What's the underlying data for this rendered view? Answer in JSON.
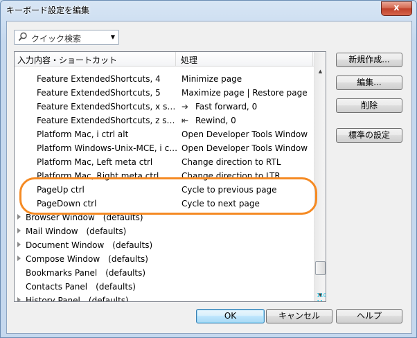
{
  "window": {
    "title": "キーボード設定を編集",
    "close_label": "x"
  },
  "search": {
    "placeholder": "クイック検索"
  },
  "list": {
    "col_shortcut": "入力内容・ショートカット",
    "col_action": "処理",
    "rows": [
      {
        "key": "Feature ExtendedShortcuts, 4",
        "action": "Minimize page"
      },
      {
        "key": "Feature ExtendedShortcuts, 5",
        "action": "Maximize page | Restore page"
      },
      {
        "key": "Feature ExtendedShortcuts, x shift",
        "icon": "fast-forward-icon",
        "action": "Fast forward, 0"
      },
      {
        "key": "Feature ExtendedShortcuts, z shift",
        "icon": "rewind-icon",
        "action": "Rewind, 0"
      },
      {
        "key": "Platform Mac, i ctrl alt",
        "action": "Open Developer Tools Window"
      },
      {
        "key": "Platform Windows-Unix-MCE, i ctrl shift",
        "action": "Open Developer Tools Window"
      },
      {
        "key": "Platform Mac, Left meta ctrl",
        "action": "Change direction to RTL"
      },
      {
        "key": "Platform Mac, Right meta ctrl",
        "action": "Change direction to LTR"
      },
      {
        "key": "PageUp ctrl",
        "action": "Cycle to previous page"
      },
      {
        "key": "PageDown ctrl",
        "action": "Cycle to next page"
      }
    ],
    "groups": [
      {
        "name": "Browser Window",
        "defaults": "(defaults)",
        "expandable": true
      },
      {
        "name": "Mail Window",
        "defaults": "(defaults)",
        "expandable": true
      },
      {
        "name": "Document Window",
        "defaults": "(defaults)",
        "expandable": true
      },
      {
        "name": "Compose Window",
        "defaults": "(defaults)",
        "expandable": true
      },
      {
        "name": "Bookmarks Panel",
        "defaults": "(defaults)",
        "expandable": false
      },
      {
        "name": "Contacts Panel",
        "defaults": "(defaults)",
        "expandable": false
      },
      {
        "name": "History Panel",
        "defaults": "(defaults)",
        "expandable": true
      }
    ]
  },
  "side_buttons": {
    "new": "新規作成...",
    "edit": "編集...",
    "delete": "削除",
    "reset": "標準の設定"
  },
  "footer": {
    "ok": "OK",
    "cancel": "キャンセル",
    "help": "ヘルプ"
  },
  "overlay": {
    "timestamp": "110時21 11:41'48\"",
    "highlight_color": "#f58a23"
  }
}
